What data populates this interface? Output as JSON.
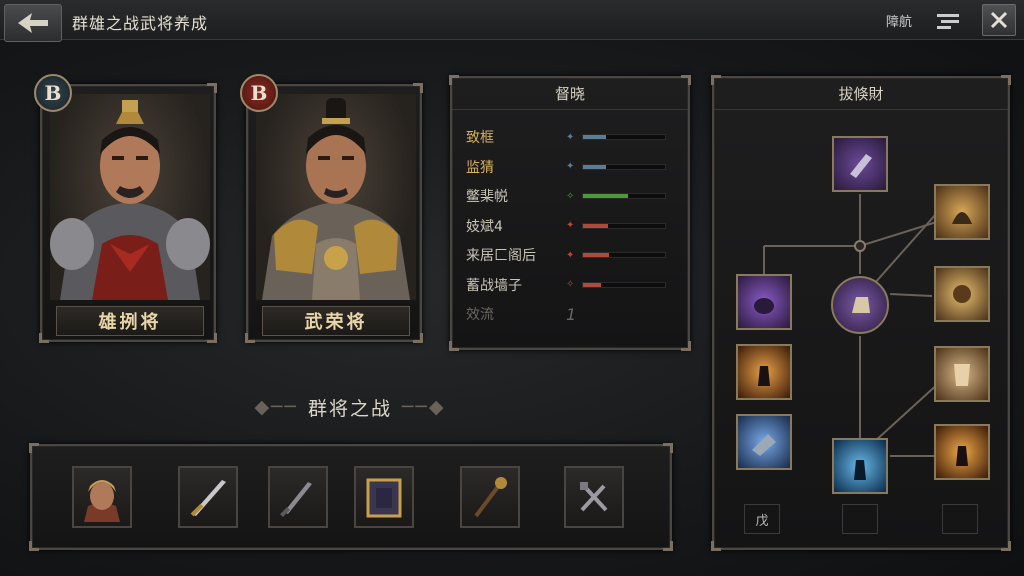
{
  "header": {
    "title": "群雄之战武将养成",
    "right_text": "障航"
  },
  "heroes": [
    {
      "name": "雄挒将",
      "rank": "B"
    },
    {
      "name": "武荣将",
      "rank": "B"
    }
  ],
  "stats_panel": {
    "title": "督晓",
    "rows": [
      {
        "label": "致框",
        "value": 0.28,
        "color": "#5b7d96",
        "label_color": "#d8b25a",
        "icon": "✦"
      },
      {
        "label": "监猜",
        "value": 0.28,
        "color": "#5b7d96",
        "label_color": "#d8b25a",
        "icon": "✦"
      },
      {
        "label": "鳖棐帨",
        "value": 0.55,
        "color": "#4a9a3a",
        "label_color": "#c9c4b8",
        "icon": "✧"
      },
      {
        "label": "妓斌4",
        "value": 0.3,
        "color": "#b04a3a",
        "label_color": "#c9c4b8",
        "icon": "✦"
      },
      {
        "label": "来居匚阁后",
        "value": 0.32,
        "color": "#b04a3a",
        "label_color": "#c9c4b8",
        "icon": "✦"
      },
      {
        "label": "蓄战墙子",
        "value": 0.22,
        "color": "#b04a3a",
        "label_color": "#c9c4b8",
        "icon": "✧"
      },
      {
        "label": "效流",
        "value_text": "1",
        "label_color": "#6a6660"
      }
    ]
  },
  "skill_panel": {
    "title": "拔倏財",
    "slots": [
      "戊",
      "",
      ""
    ]
  },
  "equipment": {
    "title": "群将之战",
    "items": [
      "helmet-hero",
      "sword",
      "dagger",
      "chest-box",
      "mace",
      "crossed-tools"
    ]
  }
}
